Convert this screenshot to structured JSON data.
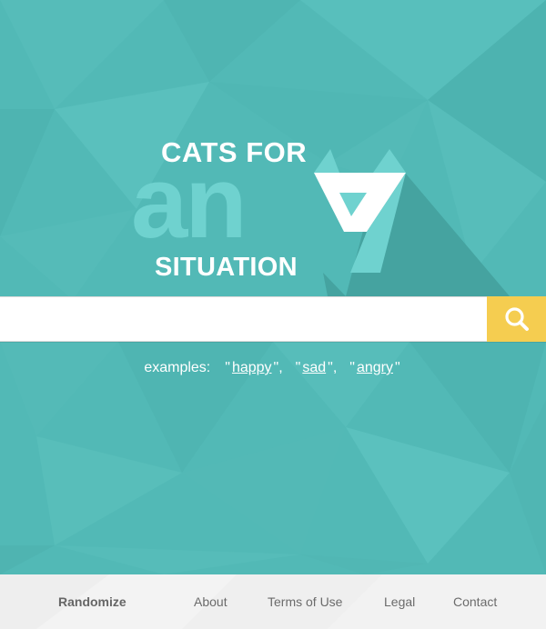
{
  "logo": {
    "line1": "CATS FOR",
    "big_word": "an",
    "line2": "SITUATION"
  },
  "search": {
    "value": "",
    "placeholder": "",
    "button_icon": "search-icon"
  },
  "examples": {
    "label": "examples:",
    "items": [
      "happy",
      "sad",
      "angry"
    ]
  },
  "footer": {
    "links": [
      "Randomize",
      "About",
      "Terms of Use",
      "Legal",
      "Contact"
    ]
  },
  "colors": {
    "background": "#52b9b6",
    "logo_accent": "#6fd2cf",
    "search_button": "#f5cd50",
    "footer": "#f1f1f1"
  }
}
